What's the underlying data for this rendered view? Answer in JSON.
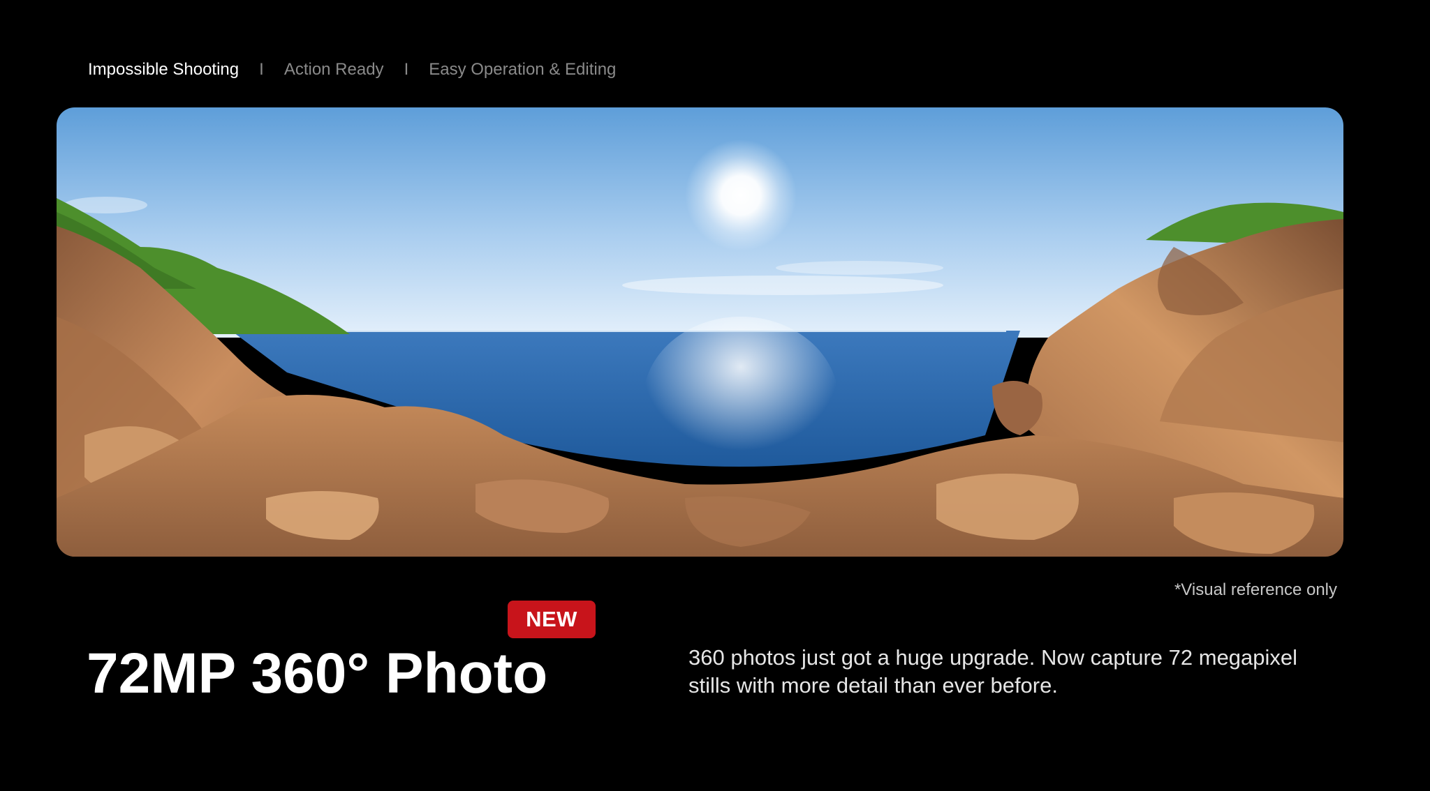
{
  "tabs": [
    {
      "label": "Impossible Shooting",
      "active": true
    },
    {
      "label": "Action Ready",
      "active": false
    },
    {
      "label": "Easy Operation & Editing",
      "active": false
    }
  ],
  "tab_separator": "I",
  "hero": {
    "image": "panorama-360-rocky-coast",
    "colors": {
      "sky_top": "#5e9ed9",
      "sky_horizon": "#e4f0fb",
      "sea": "#2f6db0",
      "rock": "#b77a4f",
      "grass": "#4d8f2c"
    }
  },
  "disclaimer": "*Visual reference only",
  "badge": "NEW",
  "headline": "72MP 360° Photo",
  "description": "360 photos just got a huge upgrade. Now capture 72 megapixel stills with more detail than ever before.",
  "colors": {
    "background": "#000000",
    "badge": "#c8141b",
    "active_tab": "#ffffff",
    "inactive_tab": "#8a8a8a"
  }
}
